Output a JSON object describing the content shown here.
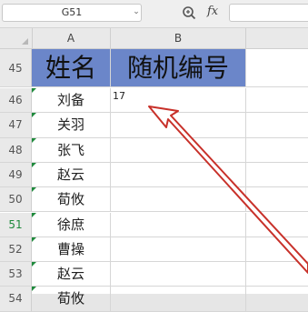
{
  "formula_bar": {
    "cell_ref": "G51",
    "dropdown_icon": "chevron-down-icon",
    "zoom_icon": "magnifier-icon",
    "fx_label": "fx",
    "formula_value": ""
  },
  "columns": [
    "A",
    "B"
  ],
  "header_row": {
    "row_number": "45",
    "col_a": "姓名",
    "col_b": "随机编号",
    "fill_color": "#6b86c9"
  },
  "rows": [
    {
      "row_number": "46",
      "name": "刘备",
      "number": "17"
    },
    {
      "row_number": "47",
      "name": "关羽",
      "number": ""
    },
    {
      "row_number": "48",
      "name": "张飞",
      "number": ""
    },
    {
      "row_number": "49",
      "name": "赵云",
      "number": ""
    },
    {
      "row_number": "50",
      "name": "荀攸",
      "number": ""
    },
    {
      "row_number": "51",
      "name": "徐庶",
      "number": ""
    },
    {
      "row_number": "52",
      "name": "曹操",
      "number": ""
    },
    {
      "row_number": "53",
      "name": "赵云",
      "number": ""
    },
    {
      "row_number": "54",
      "name": "荀攸",
      "number": ""
    }
  ],
  "annotation": {
    "arrow_color": "#c8312a",
    "points_to": "B46"
  }
}
